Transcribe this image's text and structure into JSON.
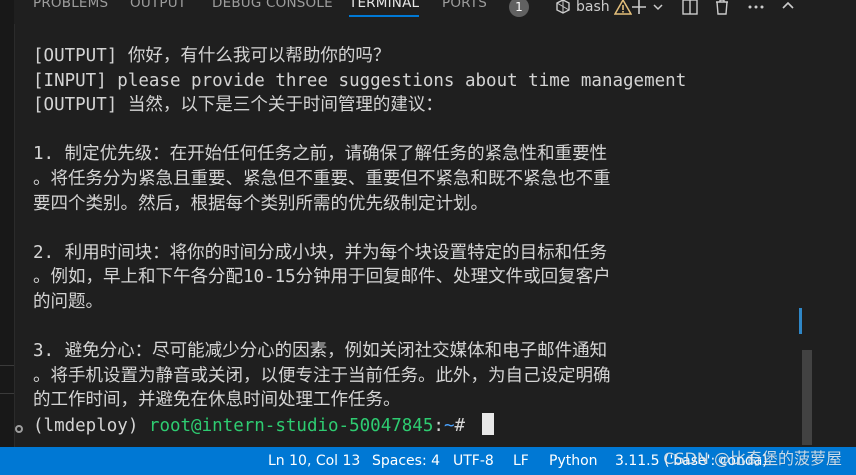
{
  "panel_tabs": [
    {
      "label": "PROBLEMS"
    },
    {
      "label": "OUTPUT"
    },
    {
      "label": "DEBUG CONSOLE"
    },
    {
      "label": "TERMINAL"
    },
    {
      "label": "PORTS"
    }
  ],
  "ports_badge": "1",
  "terminal_kind": "bash",
  "terminal_lines": [
    "[OUTPUT] 你好，有什么我可以帮助你的吗？",
    "[INPUT] please provide three suggestions about time management",
    "[OUTPUT] 当然，以下是三个关于时间管理的建议：",
    "",
    "1. 制定优先级：在开始任何任务之前，请确保了解任务的紧急性和重要性",
    "。将任务分为紧急且重要、紧急但不重要、重要但不紧急和既不紧急也不重",
    "要四个类别。然后，根据每个类别所需的优先级制定计划。",
    "",
    "2. 利用时间块：将你的时间分成小块，并为每个块设置特定的目标和任务",
    "。例如，早上和下午各分配10-15分钟用于回复邮件、处理文件或回复客户",
    "的问题。",
    "",
    "3. 避免分心：尽可能减少分心的因素，例如关闭社交媒体和电子邮件通知",
    "。将手机设置为静音或关闭，以便专注于当前任务。此外，为自己设定明确",
    "的工作时间，并避免在休息时间处理工作任务。"
  ],
  "prompt": {
    "env": "(lmdeploy) ",
    "user_host": "root@intern-studio-50047845",
    "sep": ":",
    "path": "~",
    "symbol": "# "
  },
  "status_bar": {
    "position": "Ln 10, Col 13",
    "spaces": "Spaces: 4",
    "encoding": "UTF-8",
    "eol": "LF",
    "language": "Python",
    "interpreter": "3.11.5 ('base': conda)"
  },
  "watermark": "CSDN @比奇堡的菠萝屋",
  "colors": {
    "accent": "#0078d4",
    "prompt_green": "#2ecc71",
    "prompt_blue": "#4aa3ff",
    "warning": "#e5c07b"
  },
  "icons": [
    "terminal-icon",
    "warning-icon",
    "add-icon",
    "chevron-down-icon",
    "split-terminal-icon",
    "kill-terminal-icon",
    "chevron-up-icon"
  ]
}
